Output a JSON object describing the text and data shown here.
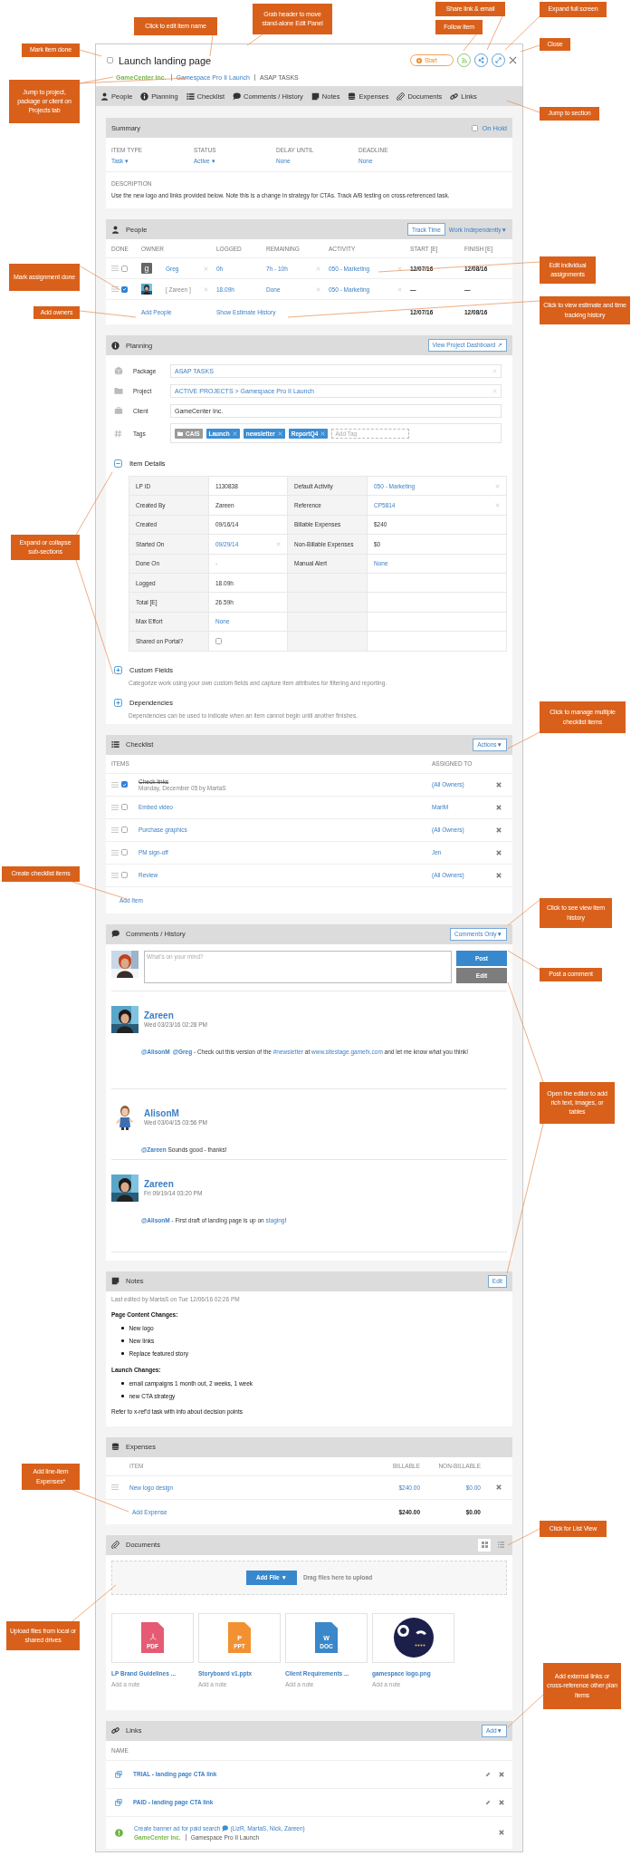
{
  "panel": {
    "title": "Launch landing page",
    "done": false,
    "breadcrumb": [
      {
        "kind": "client",
        "text": "GameCenter Inc."
      },
      {
        "kind": "link",
        "text": "Gamespace Pro II Launch"
      },
      {
        "kind": "plain",
        "text": "ASAP TASKS"
      }
    ],
    "start": "Start",
    "tabs": [
      "People",
      "Planning",
      "Checklist",
      "Comments / History",
      "Notes",
      "Expenses",
      "Documents",
      "Links"
    ]
  },
  "summary": {
    "title": "Summary",
    "on_hold": {
      "label": "On Hold",
      "checked": false
    },
    "fields": [
      {
        "label": "ITEM TYPE",
        "value": "Task ▾"
      },
      {
        "label": "STATUS",
        "value": "Active ▾"
      },
      {
        "label": "DELAY UNTIL",
        "value": "None"
      },
      {
        "label": "DEADLINE",
        "value": "None"
      }
    ],
    "description_label": "DESCRIPTION",
    "description": "Use the new logo and links provided below. Note this is a change in strategy for CTAs. Track A/B testing on cross-referenced task."
  },
  "people": {
    "title": "People",
    "buttons": [
      "Track Time",
      "Work Independently▼"
    ],
    "columns": [
      "DONE",
      "OWNER",
      "LOGGED",
      "REMAINING",
      "ACTIVITY",
      "START [E]",
      "FINISH [E]"
    ],
    "rows": [
      {
        "done": false,
        "avatar": {
          "kind": "letter",
          "text": "g"
        },
        "owner": "Greg",
        "muted": false,
        "logged": "0h",
        "remaining": "7h - 10h",
        "activity": "050 - Marketing",
        "start": "12/07/16",
        "finish": "12/08/16"
      },
      {
        "done": true,
        "owner": "[ Zareen ]",
        "muted": true,
        "logged": "18.09h",
        "remaining": "Done",
        "activity": "050 - Marketing",
        "start": "—",
        "finish": "—"
      }
    ],
    "add": "Add People",
    "history": "Show Estimate History",
    "total_start": "12/07/16",
    "total_finish": "12/08/16"
  },
  "planning": {
    "title": "Planning",
    "button": "View Project Dashboard ↗",
    "fields": [
      {
        "label": "Package",
        "kind": "link",
        "value": "ASAP TASKS"
      },
      {
        "label": "Project",
        "kind": "link",
        "value": "ACTIVE PROJECTS  >  Gamespace Pro II Launch"
      },
      {
        "label": "Client",
        "kind": "text",
        "value": "GameCenter Inc."
      }
    ],
    "tags_label": "Tags",
    "tags": [
      {
        "kind": "folder",
        "text": "CAIS"
      },
      {
        "kind": "tag",
        "text": "Launch"
      },
      {
        "kind": "tag",
        "text": "newsletter"
      },
      {
        "kind": "tag",
        "text": "ReportQ4"
      }
    ],
    "tag_placeholder": "Add Tag",
    "item_details": {
      "title": "Item Details",
      "expanded": true,
      "rows": [
        {
          "left": {
            "label": "LP ID",
            "kind": "text",
            "value": "1130838"
          },
          "right": {
            "label": "Default Activity",
            "kind": "link_clearable",
            "value": "050 - Marketing"
          }
        },
        {
          "left": {
            "label": "Created By",
            "kind": "text",
            "value": "Zareen"
          },
          "right": {
            "label": "Reference",
            "kind": "link_clearable",
            "value": "CP5814"
          }
        },
        {
          "left": {
            "label": "Created",
            "kind": "text",
            "value": "09/16/14"
          },
          "right": {
            "label": "Billable Expenses",
            "kind": "text",
            "value": "$240"
          }
        },
        {
          "left": {
            "label": "Started On",
            "kind": "link_clearable",
            "value": "09/29/14"
          },
          "right": {
            "label": "Non-Billable Expenses",
            "kind": "text",
            "value": "$0"
          }
        },
        {
          "left": {
            "label": "Done On",
            "kind": "link",
            "value": "-"
          },
          "right": {
            "label": "Manual Alert",
            "kind": "link",
            "value": "None"
          }
        },
        {
          "left": {
            "label": "Logged",
            "kind": "text",
            "value": "18.09h"
          }
        },
        {
          "left": {
            "label": "Total [E]",
            "kind": "text",
            "value": "26.59h"
          }
        },
        {
          "left": {
            "label": "Max Effort",
            "kind": "link",
            "value": "None"
          }
        },
        {
          "left": {
            "label": "Shared on Portal?",
            "kind": "checkbox",
            "checked": false
          }
        }
      ]
    },
    "subsections": [
      {
        "title": "Custom Fields",
        "expanded": false,
        "description": "Categorize work using your own custom fields and capture item attributes for filtering and reporting."
      },
      {
        "title": "Dependencies",
        "expanded": false,
        "description": "Dependencies can be used to indicate when an item cannot begin until another finishes."
      }
    ]
  },
  "checklist": {
    "title": "Checklist",
    "button": "Actions▼",
    "columns": [
      "ITEMS",
      "ASSIGNED TO"
    ],
    "items": [
      {
        "text": "Check links",
        "done": true,
        "meta": "Monday, December 05 by MartaS",
        "assignee": "(All Owners)"
      },
      {
        "text": "Embed video",
        "done": false,
        "assignee": "MariM"
      },
      {
        "text": "Purchase graphics",
        "done": false,
        "assignee": "(All Owners)"
      },
      {
        "text": "PM sign-off",
        "done": false,
        "assignee": "Jen"
      },
      {
        "text": "Review",
        "done": false,
        "assignee": "(All Owners)"
      }
    ],
    "add": "Add Item"
  },
  "comments": {
    "title": "Comments / History",
    "filter": "Comments Only▼",
    "placeholder": "What's on your mind?",
    "post": "Post",
    "edit": "Edit",
    "entries": [
      {
        "author": "Zareen",
        "time": "Wed 03/23/16 02:28 PM",
        "parts": [
          {
            "kind": "mention",
            "text": "@AlisonM"
          },
          {
            "kind": "mention",
            "text": "@Greg"
          },
          {
            "kind": "plain",
            "text": " - Check out this version of the "
          },
          {
            "kind": "link",
            "text": "#newsletter"
          },
          {
            "kind": "plain",
            "text": " at "
          },
          {
            "kind": "link",
            "text": "www.sitestage.gamefx.com"
          },
          {
            "kind": "plain",
            "text": " and let me know what you think!"
          }
        ]
      },
      {
        "author": "AlisonM",
        "kind": "figure",
        "time": "Wed 03/04/15 03:56 PM",
        "parts": [
          {
            "kind": "mention",
            "text": "@Zareen"
          },
          {
            "kind": "plain",
            "text": " Sounds good - thanks!"
          }
        ]
      },
      {
        "author": "Zareen",
        "time": "Fri 09/19/14 03:20 PM",
        "parts": [
          {
            "kind": "mention",
            "text": "@AlisonM"
          },
          {
            "kind": "plain",
            "text": " - First draft of landing page is up on "
          },
          {
            "kind": "link",
            "text": "staging"
          },
          {
            "kind": "plain",
            "text": "!"
          }
        ]
      }
    ]
  },
  "notes": {
    "title": "Notes",
    "button": "Edit",
    "meta": "Last edited by MartaS on Tue 12/06/16 02:26 PM",
    "blocks": [
      {
        "kind": "heading",
        "text": "Page Content Changes:"
      },
      {
        "kind": "list",
        "items": [
          "New logo",
          "New links",
          "Replace featured story"
        ]
      },
      {
        "kind": "heading",
        "text": "Launch Changes:"
      },
      {
        "kind": "list",
        "items": [
          "email campaigns 1 month out, 2 weeks, 1 week",
          "new CTA strategy"
        ]
      },
      {
        "kind": "paragraph",
        "text": "Refer to x-ref'd task with info about decision points"
      }
    ]
  },
  "expenses": {
    "title": "Expenses",
    "columns": [
      "ITEM",
      "BILLABLE",
      "NON-BILLABLE"
    ],
    "rows": [
      {
        "item": "New logo design",
        "billable": "$240.00",
        "non_billable": "$0.00"
      }
    ],
    "add": "Add Expense",
    "total_billable": "$240.00",
    "total_non_billable": "$0.00"
  },
  "documents": {
    "title": "Documents",
    "views": [
      {
        "kind": "grid",
        "selected": true
      },
      {
        "kind": "list",
        "selected": false
      }
    ],
    "add_file": "Add File ▼",
    "drop_hint": "Drag files here to upload",
    "files": [
      {
        "kind": "pdf",
        "badge": "PDF",
        "name": "LP Brand Guidelines ...",
        "note": "Add a note"
      },
      {
        "kind": "ppt",
        "letter": "P",
        "badge": "PPT",
        "name": "Storyboard v1.pptx",
        "note": "Add a note"
      },
      {
        "kind": "doc",
        "letter": "W",
        "badge": "DOC",
        "name": "Client Requirements ...",
        "note": "Add a note"
      },
      {
        "kind": "picture",
        "name": "gamespace logo.png",
        "note": "Add a note"
      }
    ]
  },
  "links": {
    "title": "Links",
    "button": "Add▼",
    "column": "NAME",
    "items": [
      {
        "kind": "external",
        "text": "TRIAL - landing page CTA link"
      },
      {
        "kind": "external",
        "text": "PAID - landing page CTA link"
      },
      {
        "kind": "item",
        "text": "Create banner ad for paid search",
        "owners": "(LizR, MartaS, Nick, Zareen)",
        "client": "GameCenter Inc.",
        "project": "Gamespace Pro II Launch"
      }
    ]
  },
  "callouts": [
    {
      "text": "Share link & email"
    },
    {
      "text": "Expand full screen"
    },
    {
      "text": "Grab header to move stand-alone Edit Panel"
    },
    {
      "text": "Click to edit item name"
    },
    {
      "text": "Follow item"
    },
    {
      "text": "Close"
    },
    {
      "text": "Mark item done"
    },
    {
      "text": "Jump to project, package or client on Projects tab"
    },
    {
      "text": "Jump to section"
    },
    {
      "text": "Mark assignment done"
    },
    {
      "text": "Edit individual assignments"
    },
    {
      "text": "Add owners"
    },
    {
      "text": "Click to view estimate and time tracking history"
    },
    {
      "text": "Expand or collapse sub-sections"
    },
    {
      "text": "Click to manage multiple checklist items"
    },
    {
      "text": "Create checklist items"
    },
    {
      "text": "Click to see view item history"
    },
    {
      "text": "Post a comment"
    },
    {
      "text": "Open the editor to add rich text, images, or tables"
    },
    {
      "text": "Add line-item Expenses*"
    },
    {
      "text": "Click for List View"
    },
    {
      "text": "Upload files from local or shared drives"
    },
    {
      "text": "Add external links or cross-reference other plan items"
    }
  ]
}
